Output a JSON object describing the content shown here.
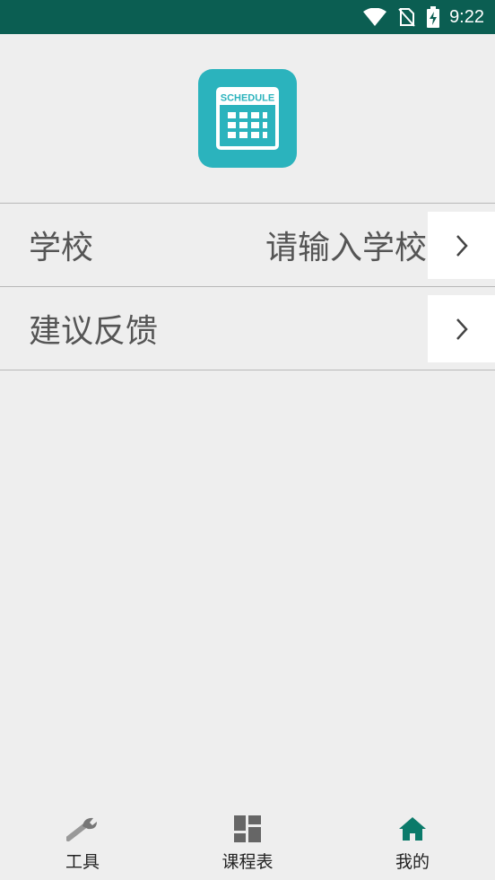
{
  "status_bar": {
    "time": "9:22",
    "icons": [
      "wifi-icon",
      "no-sim-icon",
      "battery-charging-icon"
    ]
  },
  "logo": {
    "text": "SCHEDULE",
    "color": "#2bb3bd"
  },
  "menu": {
    "school": {
      "label": "学校",
      "placeholder": "请输入学校"
    },
    "feedback": {
      "label": "建议反馈"
    }
  },
  "bottom_nav": {
    "items": [
      {
        "label": "工具",
        "icon": "wrench-icon"
      },
      {
        "label": "课程表",
        "icon": "grid-icon"
      },
      {
        "label": "我的",
        "icon": "home-icon"
      }
    ],
    "active_index": 2,
    "active_color": "#0b7a6a",
    "inactive_color": "#666666"
  }
}
